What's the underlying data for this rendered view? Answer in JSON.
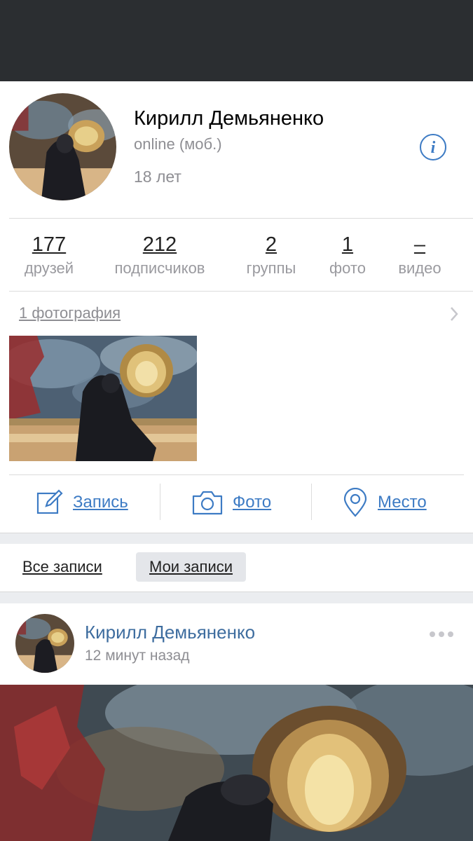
{
  "header": {
    "background": "#2b2e31"
  },
  "profile": {
    "name": "Кирилл Демьяненко",
    "status": "online (моб.)",
    "age": "18 лет",
    "info_icon": "info-icon"
  },
  "counters": [
    {
      "value": "177",
      "label": "друзей"
    },
    {
      "value": "212",
      "label": "подписчиков"
    },
    {
      "value": "2",
      "label": "группы"
    },
    {
      "value": "1",
      "label": "фото"
    },
    {
      "value": "–",
      "label": "видео"
    }
  ],
  "photos": {
    "title": "1 фотография"
  },
  "actions": [
    {
      "label": "Запись",
      "icon": "edit-icon"
    },
    {
      "label": "Фото",
      "icon": "camera-icon"
    },
    {
      "label": "Место",
      "icon": "location-pin-icon"
    }
  ],
  "filters": {
    "all": "Все записи",
    "mine": "Мои записи"
  },
  "post": {
    "author": "Кирилл Демьяненко",
    "time": "12 минут назад"
  },
  "colors": {
    "accent": "#3d7bc4",
    "author": "#3e6d9f",
    "muted": "#8e8e93"
  }
}
